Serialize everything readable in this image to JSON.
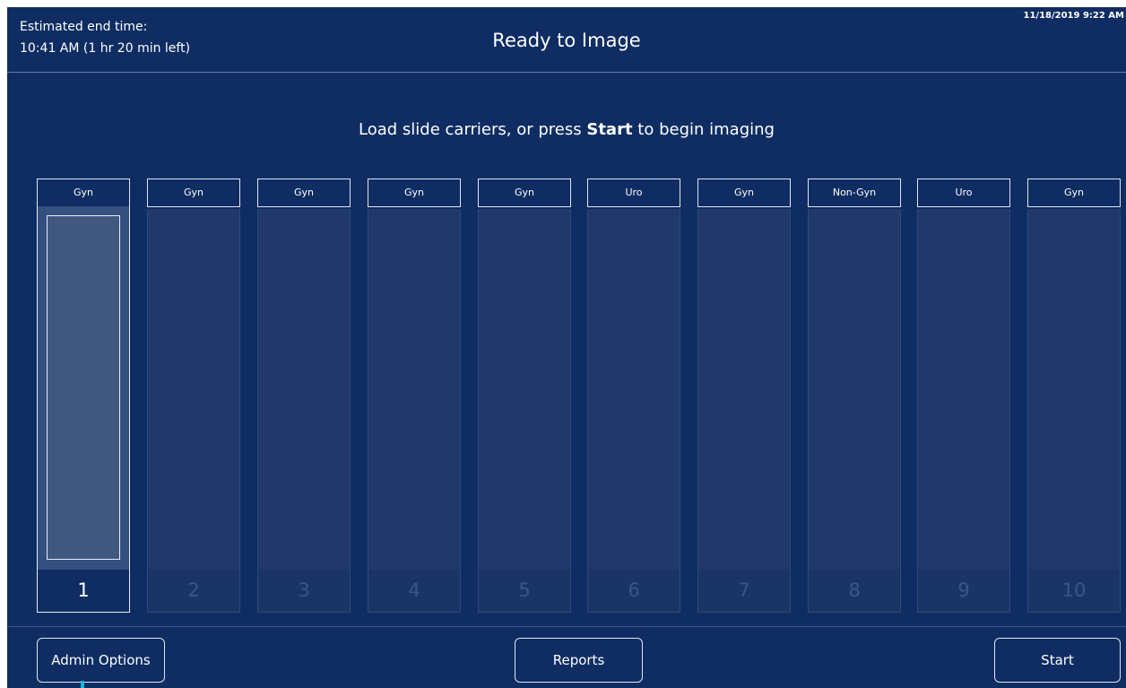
{
  "header": {
    "estimated_label": "Estimated end time:",
    "estimated_value": "10:41 AM (1 hr 20 min left)",
    "title": "Ready to Image",
    "datetime": "11/18/2019 9:22 AM"
  },
  "instruction": {
    "before": "Load slide carriers, or press ",
    "bold": "Start",
    "after": " to begin imaging"
  },
  "slots": [
    {
      "label": "Gyn",
      "number": "1",
      "active": true
    },
    {
      "label": "Gyn",
      "number": "2",
      "active": false
    },
    {
      "label": "Gyn",
      "number": "3",
      "active": false
    },
    {
      "label": "Gyn",
      "number": "4",
      "active": false
    },
    {
      "label": "Gyn",
      "number": "5",
      "active": false
    },
    {
      "label": "Uro",
      "number": "6",
      "active": false
    },
    {
      "label": "Gyn",
      "number": "7",
      "active": false
    },
    {
      "label": "Non-Gyn",
      "number": "8",
      "active": false
    },
    {
      "label": "Uro",
      "number": "9",
      "active": false
    },
    {
      "label": "Gyn",
      "number": "10",
      "active": false
    }
  ],
  "footer": {
    "admin_label": "Admin Options",
    "reports_label": "Reports",
    "start_label": "Start"
  },
  "colors": {
    "background": "#0f2d62",
    "bay_empty": "#20396a",
    "bay_loaded": "#34507f",
    "border": "#dfe6f2",
    "cursor": "#19b3e0"
  }
}
